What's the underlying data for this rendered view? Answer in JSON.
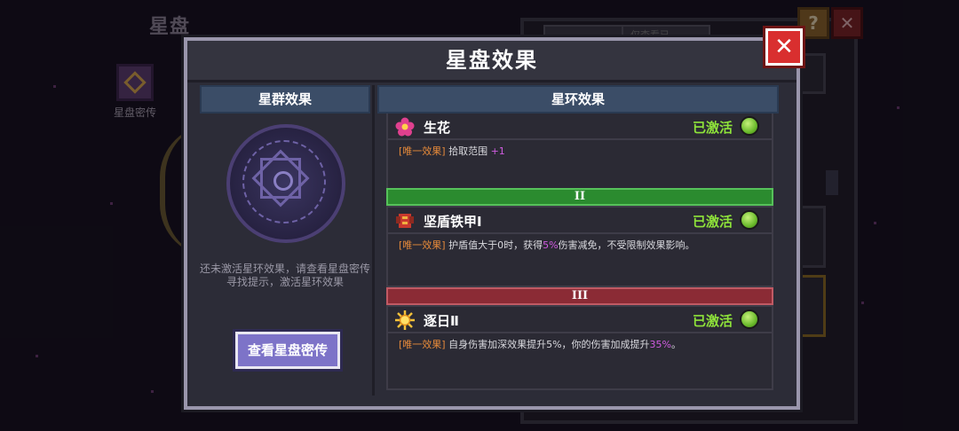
{
  "background": {
    "screen_title": "星盘",
    "side_icon_label": "星盘密传",
    "tab_left": "",
    "tab_right": "仅查看已"
  },
  "modal": {
    "title": "星盘效果",
    "close_label": "✕",
    "left": {
      "header": "星群效果",
      "hint": "还未激活星环效果，请查看星盘密传寻找提示，激活星环效果",
      "button_label": "查看星盘密传"
    },
    "right": {
      "header": "星环效果",
      "effects": [
        {
          "icon": "flower-icon",
          "name": "生花",
          "status": "已激活",
          "tag": "[唯一效果]",
          "desc_before": "拾取范围",
          "desc_highlight": "+1",
          "desc_after": ""
        },
        {
          "tier": "II",
          "icon": "armor-icon",
          "name": "坚盾铁甲Ⅰ",
          "status": "已激活",
          "tag": "[唯一效果]",
          "desc_before": "护盾值大于0时，获得",
          "desc_highlight": "5%",
          "desc_after": "伤害减免，不受限制效果影响。"
        },
        {
          "tier": "III",
          "icon": "sun-icon",
          "name": "逐日Ⅱ",
          "status": "已激活",
          "tag": "[唯一效果]",
          "desc_before": "自身伤害加深效果提升5%，你的伤害加成提升",
          "desc_highlight": "35%",
          "desc_after": "。"
        }
      ]
    }
  },
  "colors": {
    "status_green": "#8ee23a",
    "tag_orange": "#e68a3a",
    "highlight_purple": "#d05ce0",
    "tier2_green": "#2b8b2f",
    "tier3_red": "#8b2b35",
    "button_purple": "#7d73c8",
    "close_red": "#d92f2f"
  }
}
